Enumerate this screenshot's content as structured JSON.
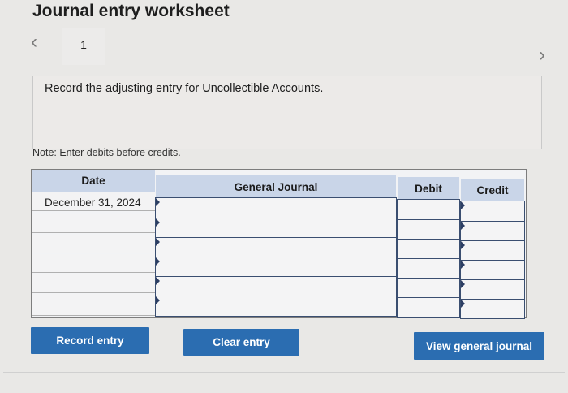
{
  "title": "Journal entry worksheet",
  "nav": {
    "prev_icon": "‹",
    "next_icon": "›"
  },
  "tab": {
    "label": "1"
  },
  "question": "Record the adjusting entry for Uncollectible Accounts.",
  "note": "Note: Enter debits before credits.",
  "table": {
    "headers": {
      "date": "Date",
      "journal": "General Journal",
      "debit": "Debit",
      "credit": "Credit"
    },
    "rows": [
      {
        "date": "December 31, 2024",
        "journal": "",
        "debit": "",
        "credit": ""
      },
      {
        "date": "",
        "journal": "",
        "debit": "",
        "credit": ""
      },
      {
        "date": "",
        "journal": "",
        "debit": "",
        "credit": ""
      },
      {
        "date": "",
        "journal": "",
        "debit": "",
        "credit": ""
      },
      {
        "date": "",
        "journal": "",
        "debit": "",
        "credit": ""
      },
      {
        "date": "",
        "journal": "",
        "debit": "",
        "credit": ""
      }
    ]
  },
  "buttons": {
    "record": "Record entry",
    "clear": "Clear entry",
    "view": "View general journal"
  },
  "colors": {
    "button": "#2b6db1",
    "header": "#c9d5e8",
    "border": "#3a4e70"
  }
}
